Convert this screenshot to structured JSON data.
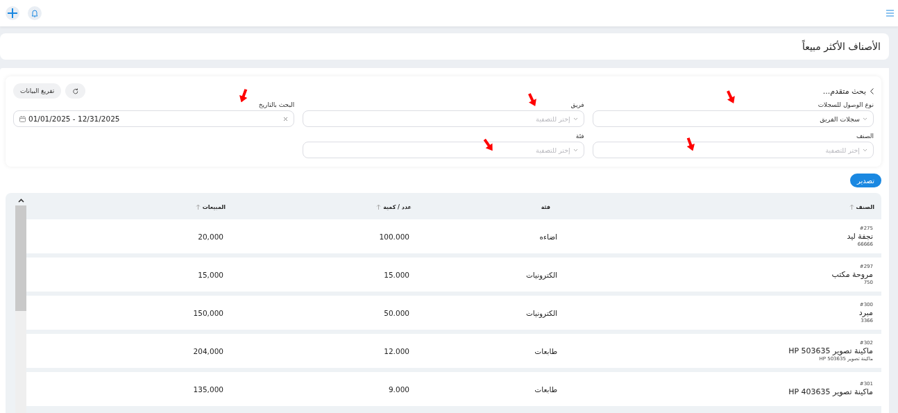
{
  "page_title": "الأصناف الأكثر مبيعاً",
  "filters": {
    "toggle_label": "بحث متقدم...",
    "clear_button": "تفريغ البيانات",
    "fields": [
      {
        "kind": "select",
        "label": "نوع الوصول للسجلات",
        "value": "سجلات الفريق"
      },
      {
        "kind": "select",
        "label": "فريق",
        "placeholder": "إختر للتصفية"
      },
      {
        "kind": "date",
        "label": "البحث بالتاريخ",
        "value": "01/01/2025 - 12/31/2025"
      },
      {
        "kind": "select",
        "label": "الصنف",
        "placeholder": "إختر للتصفية"
      },
      {
        "kind": "select",
        "label": "فئة",
        "placeholder": "إختر للتصفية"
      }
    ]
  },
  "export_button": "تصدير",
  "table": {
    "columns": [
      {
        "label": "الصنف",
        "sortable": true
      },
      {
        "label": "فئة",
        "sortable": false
      },
      {
        "label": "عدد / كمية",
        "sortable": true
      },
      {
        "label": "المبيعات",
        "sortable": true
      }
    ],
    "rows": [
      {
        "id": "#275",
        "name": "نجفة ليد",
        "code": "66666",
        "category": "اضاءه",
        "quantity": "100.000",
        "sales": "20,000"
      },
      {
        "id": "#297",
        "name": "مروحة مكتب",
        "code": "750",
        "category": "الكترونيات",
        "quantity": "15.000",
        "sales": "15,000"
      },
      {
        "id": "#300",
        "name": "مبرد",
        "code": "3366",
        "category": "الكترونيات",
        "quantity": "50.000",
        "sales": "150,000"
      },
      {
        "id": "#302",
        "name": "ماكينة تصوير HP 503635",
        "code": "ماكينة تصوير HP 503635",
        "category": "طابعات",
        "quantity": "12.000",
        "sales": "204,000"
      },
      {
        "id": "#301",
        "name": "ماكينة تصوير HP 403635",
        "category": "طابعات",
        "quantity": "9.000",
        "sales": "135,000"
      }
    ]
  }
}
